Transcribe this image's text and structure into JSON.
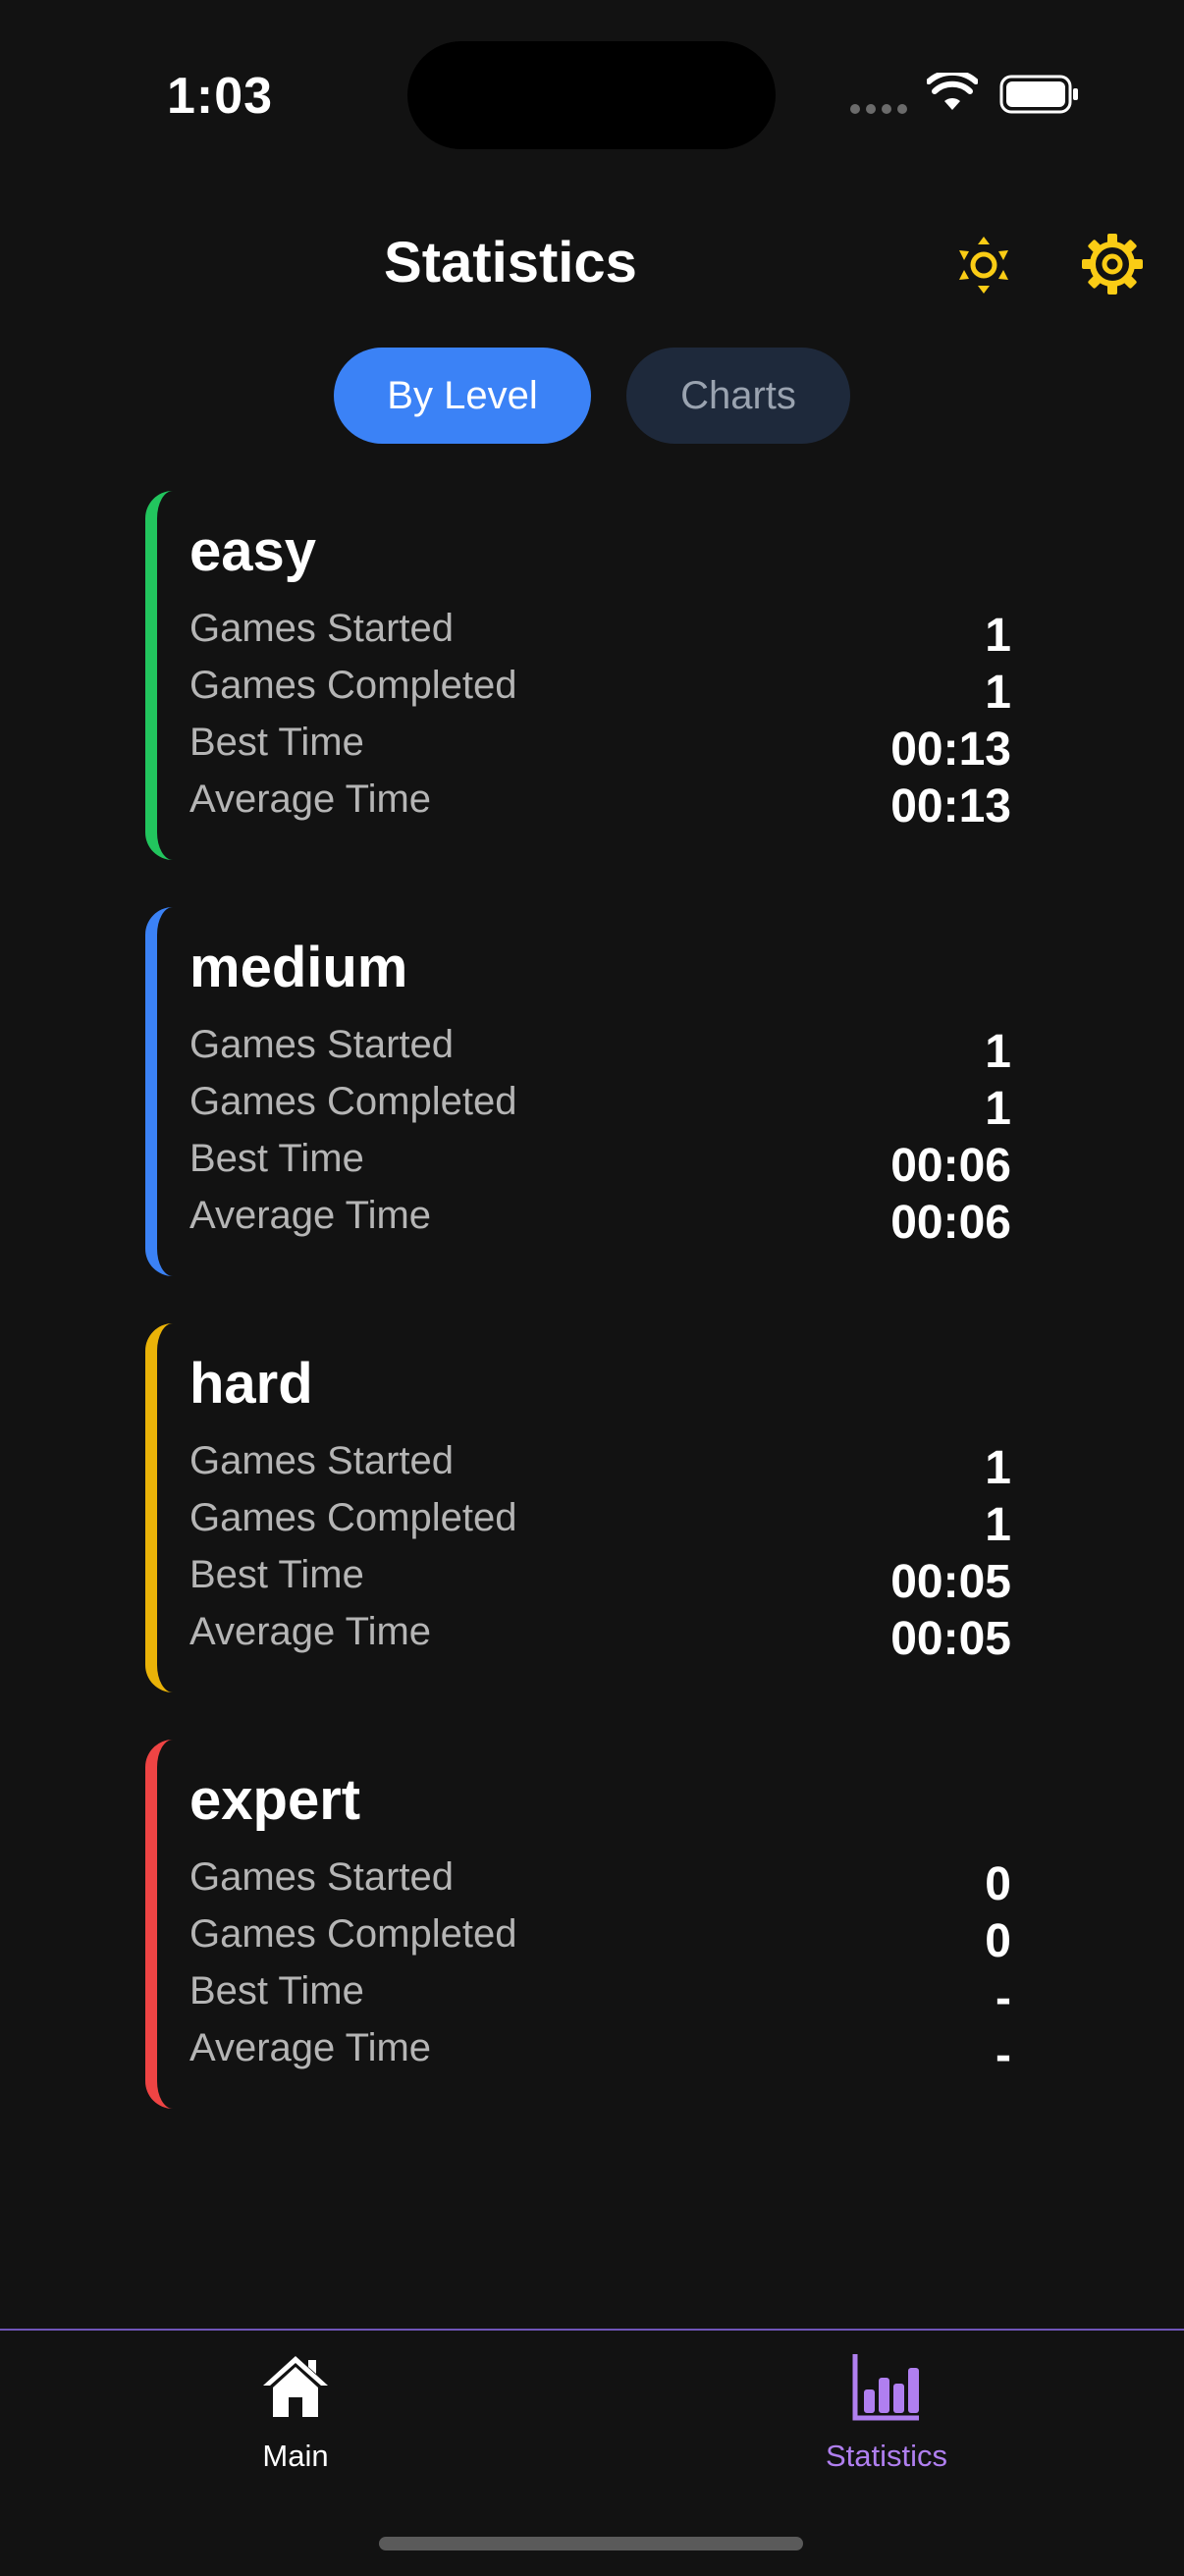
{
  "status_bar": {
    "time": "1:03"
  },
  "header": {
    "title": "Statistics",
    "theme_icon": "sun-icon",
    "settings_icon": "gear-icon"
  },
  "tabs": [
    {
      "label": "By Level",
      "selected": true
    },
    {
      "label": "Charts",
      "selected": false
    }
  ],
  "levels": [
    {
      "name": "easy",
      "color": "#22c55e",
      "stats": [
        {
          "label": "Games Started",
          "value": "1"
        },
        {
          "label": "Games Completed",
          "value": "1"
        },
        {
          "label": "Best Time",
          "value": "00:13"
        },
        {
          "label": "Average Time",
          "value": "00:13"
        }
      ]
    },
    {
      "name": "medium",
      "color": "#3b82f6",
      "stats": [
        {
          "label": "Games Started",
          "value": "1"
        },
        {
          "label": "Games Completed",
          "value": "1"
        },
        {
          "label": "Best Time",
          "value": "00:06"
        },
        {
          "label": "Average Time",
          "value": "00:06"
        }
      ]
    },
    {
      "name": "hard",
      "color": "#eab308",
      "stats": [
        {
          "label": "Games Started",
          "value": "1"
        },
        {
          "label": "Games Completed",
          "value": "1"
        },
        {
          "label": "Best Time",
          "value": "00:05"
        },
        {
          "label": "Average Time",
          "value": "00:05"
        }
      ]
    },
    {
      "name": "expert",
      "color": "#ef4444",
      "stats": [
        {
          "label": "Games Started",
          "value": "0"
        },
        {
          "label": "Games Completed",
          "value": "0"
        },
        {
          "label": "Best Time",
          "value": "-"
        },
        {
          "label": "Average Time",
          "value": "-"
        }
      ]
    }
  ],
  "bottom_nav": [
    {
      "label": "Main",
      "icon": "home-icon",
      "active": false
    },
    {
      "label": "Statistics",
      "icon": "bar-chart-icon",
      "active": true
    }
  ],
  "colors": {
    "background": "#121212",
    "accent": "#3b82f6",
    "icon_yellow": "#facc15",
    "active_nav": "#b07ff0"
  }
}
